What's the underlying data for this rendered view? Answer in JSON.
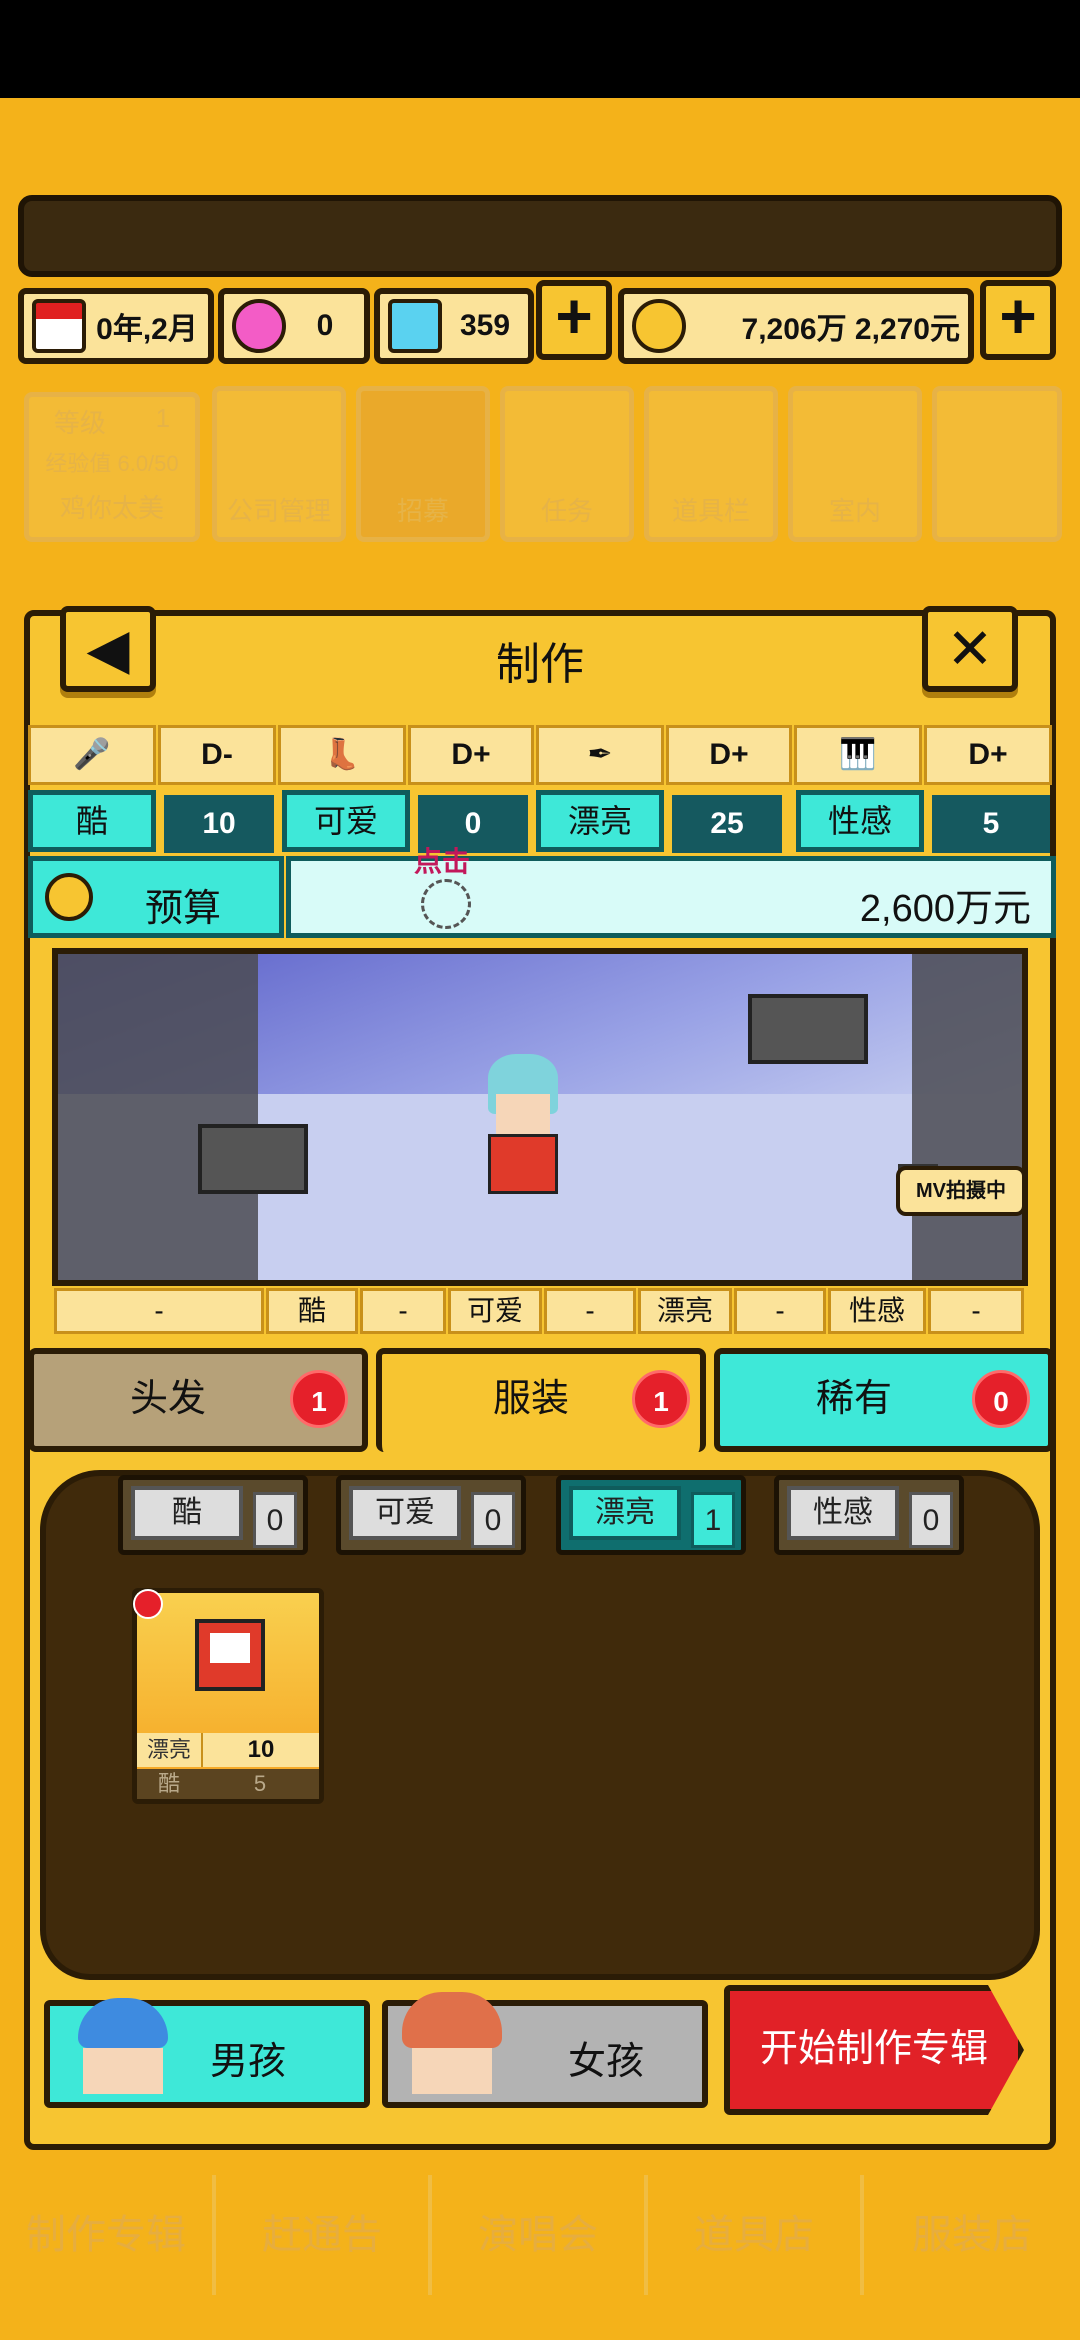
{
  "resources": {
    "date": "0年,2月",
    "gems_pink": "0",
    "diamonds": "359",
    "money": "7,206万 2,270元"
  },
  "background_ui": {
    "level_label": "等级",
    "level_value": "1",
    "exp": "经验值 6.0/50",
    "player_name": "鸡你太美",
    "menu": [
      "公司管理",
      "招募",
      "任务",
      "道具栏",
      "室内"
    ],
    "nav": [
      "制作专辑",
      "赶通告",
      "演唱会",
      "道具店",
      "服装店"
    ]
  },
  "panel": {
    "title": "制作",
    "grades": [
      "D-",
      "D+",
      "D+",
      "D+"
    ],
    "stats": [
      {
        "label": "酷",
        "value": "10"
      },
      {
        "label": "可爱",
        "value": "0"
      },
      {
        "label": "漂亮",
        "value": "25"
      },
      {
        "label": "性感",
        "value": "5"
      }
    ],
    "budget_label": "预算",
    "budget_value": "2,600万元",
    "tap_hint": "点击",
    "mv_badge": "MV拍摄中",
    "slots": [
      "-",
      "酷",
      "-",
      "可爱",
      "-",
      "漂亮",
      "-",
      "性感",
      "-"
    ]
  },
  "tabs": [
    {
      "label": "头发",
      "count": "1"
    },
    {
      "label": "服装",
      "count": "1"
    },
    {
      "label": "稀有",
      "count": "0"
    }
  ],
  "filters": [
    {
      "label": "酷",
      "count": "0"
    },
    {
      "label": "可爱",
      "count": "0"
    },
    {
      "label": "漂亮",
      "count": "1"
    },
    {
      "label": "性感",
      "count": "0"
    }
  ],
  "item_card": {
    "stat1_label": "漂亮",
    "stat1_value": "10",
    "stat2_label": "酷",
    "stat2_value": "5"
  },
  "bottom": {
    "boy": "男孩",
    "girl": "女孩",
    "start": "开始制作专辑"
  },
  "colors": {
    "panel_yellow": "#f7c531",
    "teal": "#3ee8d8",
    "dark_teal": "#15595f",
    "badge_red": "#e5202a",
    "start_red": "#e12127"
  }
}
